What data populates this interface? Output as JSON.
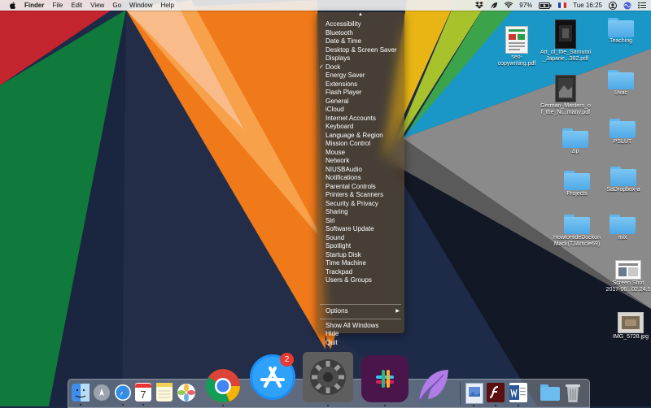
{
  "menubar": {
    "app": "Finder",
    "items": [
      "File",
      "Edit",
      "View",
      "Go",
      "Window",
      "Help"
    ],
    "battery": "97%",
    "clock": "Tue 16:25",
    "status_icons": [
      "dropbox-icon",
      "feather-icon",
      "battery-charging-icon",
      "wifi-icon",
      "flag-icon",
      "user-icon",
      "siri-icon",
      "notification-center-icon"
    ]
  },
  "desktop_icons": [
    {
      "label": "seo-\ncopywriting.pdf"
    },
    {
      "label": "Art_of_the_Samurai\n_Japane...382.pdf"
    },
    {
      "label": "Teaching"
    },
    {
      "label": "German_Masters_o\nf_the_Ni...many.pdf"
    },
    {
      "label": "Uvac"
    },
    {
      "label": "zip"
    },
    {
      "label": "PSLUT"
    },
    {
      "label": "Projects"
    },
    {
      "label": "SaDropbox-a"
    },
    {
      "label": "HowtoHideDockon\nMack(TJArticle69)"
    },
    {
      "label": "mix"
    },
    {
      "label": "Screen Shot\n2017-06...02.24.5"
    },
    {
      "label": "IMG_5728.jpg"
    }
  ],
  "context_menu": {
    "checked": "Dock",
    "items": [
      "Accessibility",
      "Bluetooth",
      "Date & Time",
      "Desktop & Screen Saver",
      "Displays",
      "Dock",
      "Energy Saver",
      "Extensions",
      "Flash Player",
      "General",
      "iCloud",
      "Internet Accounts",
      "Keyboard",
      "Language & Region",
      "Mission Control",
      "Mouse",
      "Network",
      "NIUSBAudio",
      "Notifications",
      "Parental Controls",
      "Printers & Scanners",
      "Security & Privacy",
      "Sharing",
      "Siri",
      "Software Update",
      "Sound",
      "Spotlight",
      "Startup Disk",
      "Time Machine",
      "Trackpad",
      "Users & Groups"
    ],
    "options": "Options",
    "lower_items": [
      "Show All Windows",
      "Hide",
      "Quit"
    ]
  },
  "dock": {
    "app_store_badge": "2",
    "calendar_day": "7",
    "apps": [
      "finder-icon",
      "launchpad-icon",
      "safari-icon",
      "calendar-icon",
      "notes-icon",
      "photos-icon",
      "chrome-icon",
      "app-store-icon",
      "system-preferences-icon",
      "slack-icon",
      "feather-app-icon",
      "preview-doc-icon",
      "flash-doc-icon",
      "word-doc-icon",
      "downloads-folder-icon",
      "trash-icon"
    ]
  },
  "colors": {
    "accent_orange": "#f07a1a",
    "badge_red": "#e53b30",
    "folder_blue": "#5fb6ec"
  }
}
